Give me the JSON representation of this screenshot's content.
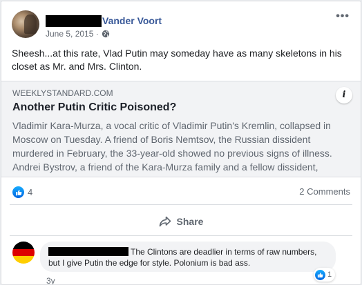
{
  "post": {
    "author_suffix": "Vander Voort",
    "date": "June 5, 2015 ·",
    "more_icon": "more-options-icon",
    "text": "Sheesh...at this rate, Vlad Putin may someday have as many skeletons in his closet as Mr. and Mrs. Clinton."
  },
  "link_preview": {
    "domain": "WEEKLYSTANDARD.COM",
    "title": "Another Putin Critic Poisoned?",
    "description": "Vladimir Kara-Murza, a vocal critic of Vladimir Putin's Kremlin, collapsed in Moscow on Tuesday. A friend of Boris Nemtsov, the Russian dissident murdered in February, the 33-year-old showed no previous signs of illness. Andrei Bystrov, a friend of the Kara-Murza family and a fellow dissident,",
    "info_label": "i"
  },
  "engagement": {
    "reaction_count": "4",
    "comments_label": "2 Comments",
    "share_label": "Share"
  },
  "comment": {
    "text": "The Clintons are deadlier in terms of raw numbers, but I give Putin the edge for style. Polonium is bad ass.",
    "reaction_count": "1",
    "time": "3y"
  },
  "colors": {
    "accent_blue": "#385898",
    "like_blue": "#0165e1",
    "muted_text": "#606770"
  }
}
